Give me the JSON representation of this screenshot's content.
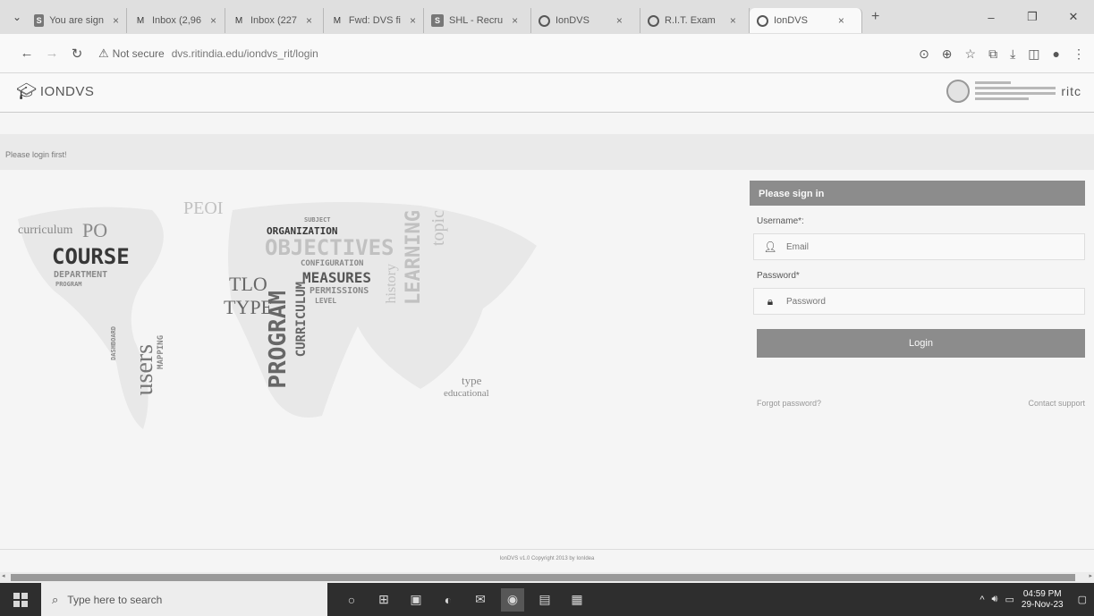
{
  "browser": {
    "tabs": [
      {
        "label": "You are sign",
        "icon": "S"
      },
      {
        "label": "Inbox (2,96",
        "icon": "M"
      },
      {
        "label": "Inbox (227",
        "icon": "M"
      },
      {
        "label": "Fwd: DVS fi",
        "icon": "M"
      },
      {
        "label": "SHL - Recru",
        "icon": "S"
      },
      {
        "label": "IonDVS",
        "icon": "globe"
      },
      {
        "label": "R.I.T. Exam",
        "icon": "globe"
      },
      {
        "label": "IonDVS",
        "icon": "globe",
        "active": true
      }
    ],
    "not_secure": "Not secure",
    "url": "dvs.ritindia.edu/iondvs_rit/login"
  },
  "header": {
    "logo_text": "IONDVS",
    "institute_short": "ritc"
  },
  "notice": "Please login first!",
  "wordmap": {
    "words": [
      "curriculum",
      "PO",
      "PEOI",
      "COURSE",
      "DEPARTMENT",
      "PROGRAM",
      "ORGANIZATION",
      "OBJECTIVES",
      "CONFIGURATION",
      "MEASURES",
      "PERMISSIONS",
      "LEARNING",
      "topic",
      "history",
      "TLO",
      "TYPE",
      "PROGRAM",
      "CURRICULUM",
      "LEVEL",
      "users",
      "MAPPING",
      "DASHBOARD",
      "type",
      "educational",
      "SUBJECT"
    ]
  },
  "login": {
    "title": "Please sign in",
    "username_label": "Username*:",
    "username_placeholder": "Email",
    "password_label": "Password*",
    "password_placeholder": "Password",
    "login_button": "Login",
    "forgot": "Forgot password?",
    "support": "Contact support"
  },
  "footer": "IonDVS v1.0 Copyright 2013 by IonIdea",
  "taskbar": {
    "search_placeholder": "Type here to search",
    "time": "04:59 PM",
    "date": "29-Nov-23"
  }
}
